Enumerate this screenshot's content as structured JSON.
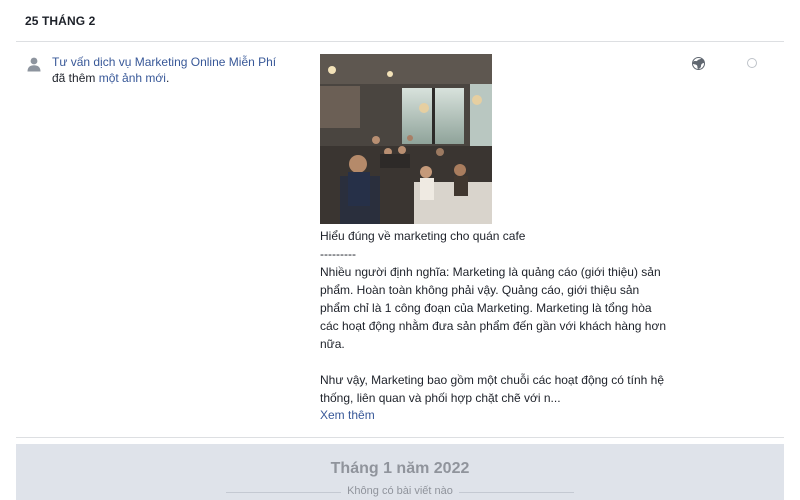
{
  "date_header": "25 THÁNG 2",
  "activity": {
    "actor_name": "Tư vấn dịch vụ Marketing Online Miễn Phí",
    "action_text": " đã thêm ",
    "object_link": "một ảnh mới",
    "action_suffix": "."
  },
  "post": {
    "text": "Hiểu đúng về marketing cho quán cafe\n---------\nNhiều người định nghĩa: Marketing là quảng cáo (giới thiệu) sản phẩm. Hoàn toàn không phải vậy. Quảng cáo, giới thiệu sản phẩm chỉ là 1 công đoạn của Marketing. Marketing là tổng hòa các hoạt động nhằm đưa sản phẩm đến gần với khách hàng hơn nữa.\n\nNhư vậy, Marketing bao gồm một chuỗi các hoạt động có tính hệ thống, liên quan và phối hợp chặt chẽ với n...",
    "see_more": "Xem thêm"
  },
  "icons": {
    "actor": "person-icon",
    "audience": "globe-icon",
    "select": "radio-button-icon"
  },
  "year_section": {
    "month_title": "Tháng 1 năm 2022",
    "no_posts": "Không có bài viết nào"
  },
  "colors": {
    "link": "#385898",
    "text": "#1d2129",
    "muted": "#90949c",
    "section_bg": "#dfe3ea"
  }
}
